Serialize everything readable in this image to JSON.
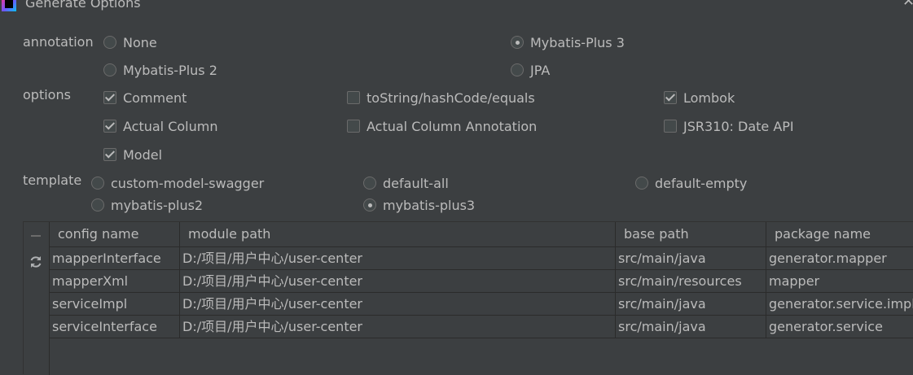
{
  "window": {
    "title": "Generate Options",
    "close_icon": "close-icon",
    "app_icon": "intellij-icon"
  },
  "annotation": {
    "label": "annotation",
    "options": [
      {
        "label": "None",
        "selected": false
      },
      {
        "label": "Mybatis-Plus 3",
        "selected": true
      },
      {
        "label": "Mybatis-Plus 2",
        "selected": false
      },
      {
        "label": "JPA",
        "selected": false
      }
    ]
  },
  "options": {
    "label": "options",
    "items": [
      {
        "label": "Comment",
        "checked": true
      },
      {
        "label": "toString/hashCode/equals",
        "checked": false
      },
      {
        "label": "Lombok",
        "checked": true
      },
      {
        "label": "Actual Column",
        "checked": true
      },
      {
        "label": "Actual Column Annotation",
        "checked": false
      },
      {
        "label": "JSR310: Date API",
        "checked": false
      },
      {
        "label": "Model",
        "checked": true
      }
    ]
  },
  "template": {
    "label": "template",
    "options": [
      {
        "label": "custom-model-swagger",
        "selected": false
      },
      {
        "label": "default-all",
        "selected": false
      },
      {
        "label": "default-empty",
        "selected": false
      },
      {
        "label": "mybatis-plus2",
        "selected": false
      },
      {
        "label": "mybatis-plus3",
        "selected": true
      }
    ]
  },
  "table": {
    "toolbar": {
      "remove_icon": "minus-icon",
      "refresh_icon": "refresh-icon"
    },
    "headers": [
      "config name",
      "module path",
      "base path",
      "package name"
    ],
    "rows": [
      [
        "mapperInterface",
        "D:/项目/用户中心/user-center",
        "src/main/java",
        "generator.mapper"
      ],
      [
        "mapperXml",
        "D:/项目/用户中心/user-center",
        "src/main/resources",
        "mapper"
      ],
      [
        "serviceImpl",
        "D:/项目/用户中心/user-center",
        "src/main/java",
        "generator.service.impl"
      ],
      [
        "serviceInterface",
        "D:/项目/用户中心/user-center",
        "src/main/java",
        "generator.service"
      ]
    ]
  }
}
